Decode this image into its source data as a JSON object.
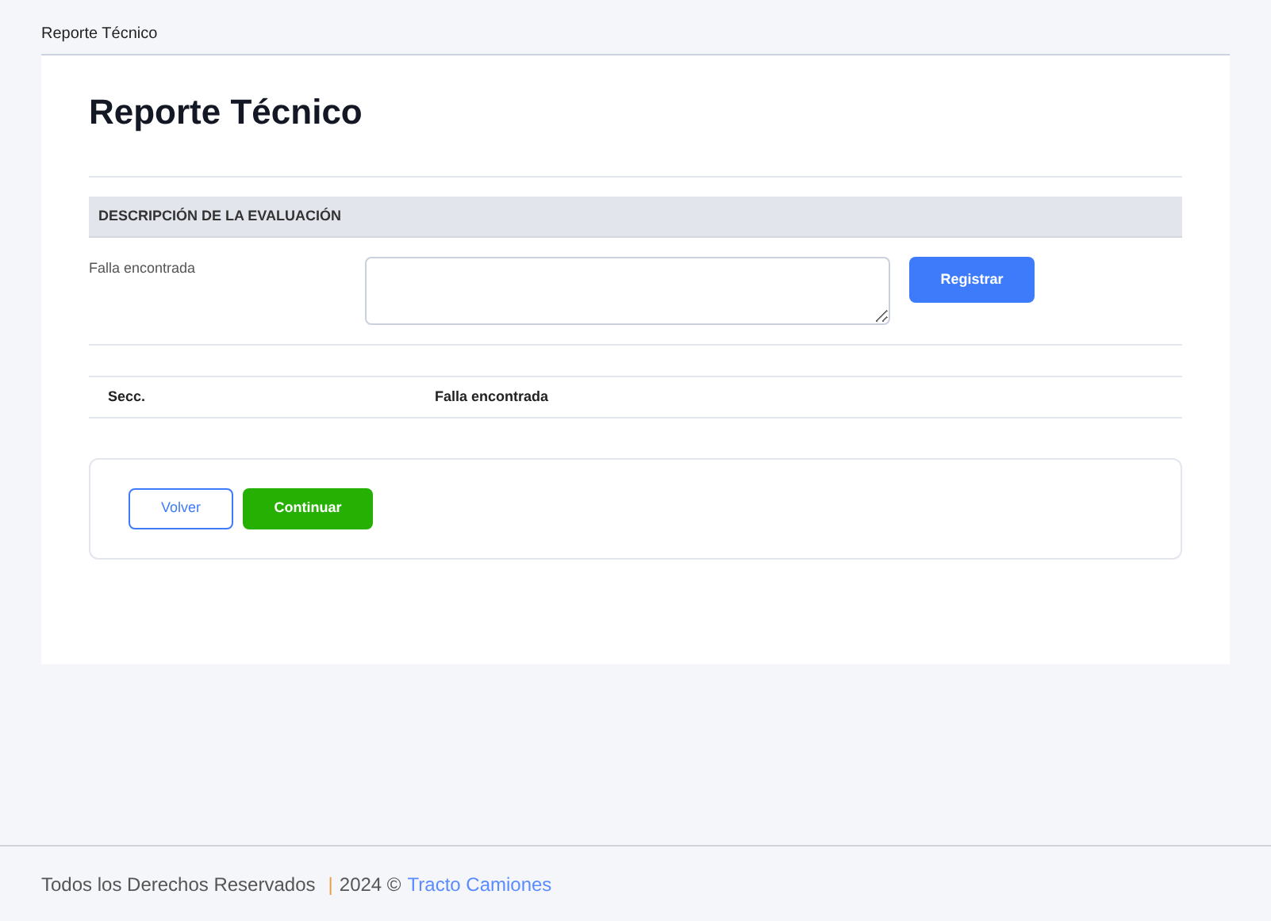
{
  "breadcrumb": "Reporte Técnico",
  "title": "Reporte Técnico",
  "section": {
    "heading": "DESCRIPCIÓN DE LA EVALUACIÓN",
    "field_label": "Falla encontrada",
    "button": "Registrar"
  },
  "table": {
    "columns": [
      "Secc.",
      "Falla encontrada"
    ]
  },
  "actions": {
    "back": "Volver",
    "continue": "Continuar"
  },
  "footer": {
    "rights": "Todos los Derechos Reservados",
    "separator": "|",
    "year": "2024 ©",
    "link": "Tracto Camiones"
  }
}
